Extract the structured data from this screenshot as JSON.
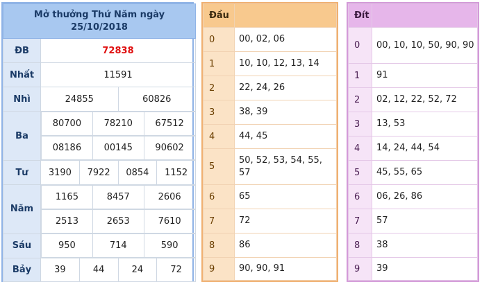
{
  "results": {
    "title_line1": "Mở thưởng Thứ Năm ngày",
    "title_line2": "25/10/2018",
    "rows": {
      "db": {
        "label": "ĐB",
        "values": [
          "72838"
        ]
      },
      "nhat": {
        "label": "Nhất",
        "values": [
          "11591"
        ]
      },
      "nhi": {
        "label": "Nhì",
        "values": [
          "24855",
          "60826"
        ]
      },
      "ba": {
        "label": "Ba",
        "values": [
          "80700",
          "78210",
          "67512",
          "08186",
          "00145",
          "90602"
        ]
      },
      "tu": {
        "label": "Tư",
        "values": [
          "3190",
          "7922",
          "0854",
          "1152"
        ]
      },
      "nam": {
        "label": "Năm",
        "values": [
          "1165",
          "8457",
          "2606",
          "2513",
          "2653",
          "7610"
        ]
      },
      "sau": {
        "label": "Sáu",
        "values": [
          "950",
          "714",
          "590"
        ]
      },
      "bay": {
        "label": "Bảy",
        "values": [
          "39",
          "44",
          "24",
          "72"
        ]
      }
    }
  },
  "dau": {
    "header": "Đầu",
    "rows": [
      {
        "key": "0",
        "values": "00, 02, 06"
      },
      {
        "key": "1",
        "values": "10, 10, 12, 13, 14"
      },
      {
        "key": "2",
        "values": "22, 24, 26"
      },
      {
        "key": "3",
        "values": "38, 39"
      },
      {
        "key": "4",
        "values": "44, 45"
      },
      {
        "key": "5",
        "values": "50, 52, 53, 54, 55, 57"
      },
      {
        "key": "6",
        "values": "65"
      },
      {
        "key": "7",
        "values": "72"
      },
      {
        "key": "8",
        "values": "86"
      },
      {
        "key": "9",
        "values": "90, 90, 91"
      }
    ]
  },
  "dit": {
    "header": "Đít",
    "rows": [
      {
        "key": "0",
        "values": "00, 10, 10, 50, 90, 90"
      },
      {
        "key": "1",
        "values": "91"
      },
      {
        "key": "2",
        "values": "02, 12, 22, 52, 72"
      },
      {
        "key": "3",
        "values": "13, 53"
      },
      {
        "key": "4",
        "values": "14, 24, 44, 54"
      },
      {
        "key": "5",
        "values": "45, 55, 65"
      },
      {
        "key": "6",
        "values": "06, 26, 86"
      },
      {
        "key": "7",
        "values": "57"
      },
      {
        "key": "8",
        "values": "38"
      },
      {
        "key": "9",
        "values": "39"
      }
    ]
  },
  "colors": {
    "results_header_bg": "#a8c8f0",
    "results_label_bg": "#dde8f7",
    "special_prize_text": "#e01010",
    "dau_header_bg": "#f8c98e",
    "dau_key_bg": "#fbe3c6",
    "dit_header_bg": "#e6b6ea",
    "dit_key_bg": "#f6e4f7"
  }
}
